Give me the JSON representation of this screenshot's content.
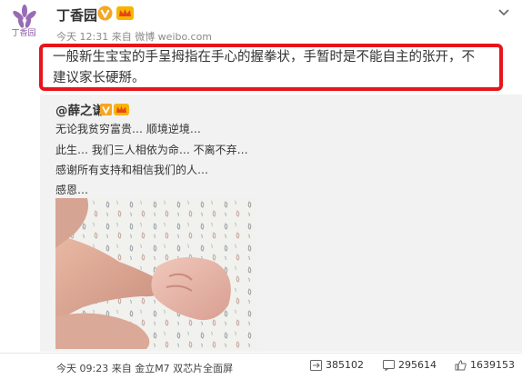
{
  "author": {
    "logo_text": "丁香园",
    "name": "丁香园",
    "meta": "今天 12:31 来自 微博 weibo.com"
  },
  "post": {
    "text": "一般新生宝宝的手呈拇指在手心的握拳状，手暂时是不能自主的张开，不建议家长硬掰。"
  },
  "repost": {
    "user": "@薛之谦",
    "lines": [
      "无论我贫穷富贵… 顺境逆境…",
      "此生… 我们三人相依为命… 不离不弃…",
      "感谢所有支持和相信我们的人…",
      "感恩…"
    ]
  },
  "footer": {
    "meta": "今天 09:23 来自 金立M7 双芯片全面屏",
    "reposts": "385102",
    "comments": "295614",
    "likes": "1639153"
  },
  "icons": {
    "verify": "verified-v-icon",
    "crown": "vip-crown-icon",
    "menu": "chevron-down-icon",
    "repost": "repost-icon",
    "comment": "comment-icon",
    "like": "like-icon"
  },
  "colors": {
    "highlight": "#e8141b",
    "verify": "#f5a623",
    "brand_purple": "#8c5aa6"
  }
}
